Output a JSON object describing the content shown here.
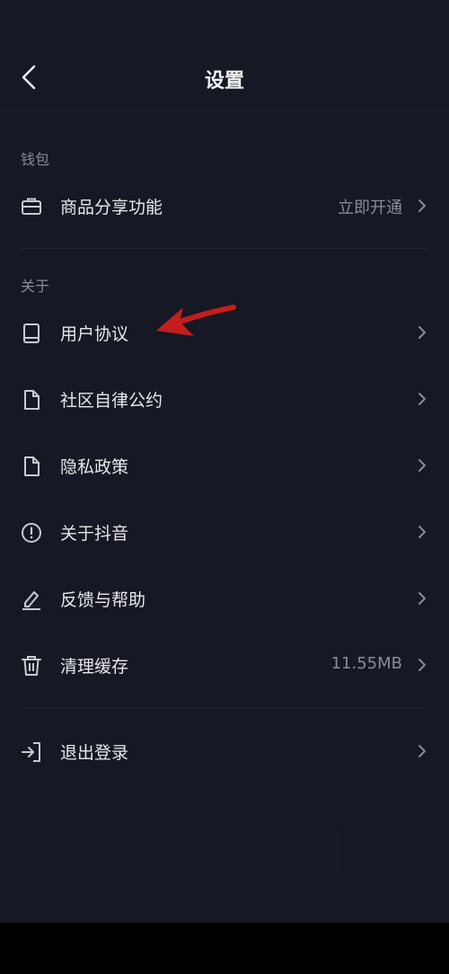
{
  "header": {
    "title": "设置"
  },
  "sections": {
    "wallet": {
      "label": "钱包"
    },
    "about": {
      "label": "关于"
    }
  },
  "rows": {
    "share": {
      "label": "商品分享功能",
      "value": "立即开通"
    },
    "agreement": {
      "label": "用户协议"
    },
    "community": {
      "label": "社区自律公约"
    },
    "privacy": {
      "label": "隐私政策"
    },
    "about_app": {
      "label": "关于抖音"
    },
    "feedback": {
      "label": "反馈与帮助"
    },
    "cache": {
      "label": "清理缓存",
      "value": "11.55MB"
    },
    "logout": {
      "label": "退出登录"
    }
  },
  "annotation": {
    "arrow_color": "#c41d1d"
  },
  "icons": [
    "back-icon",
    "briefcase-icon",
    "book-icon",
    "document-icon",
    "info-icon",
    "edit-icon",
    "trash-icon",
    "logout-icon",
    "chevron-right-icon"
  ]
}
